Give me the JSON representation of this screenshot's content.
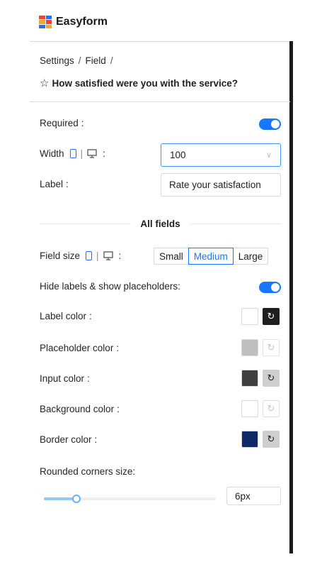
{
  "app": {
    "brand": "Easyform"
  },
  "breadcrumb": {
    "items": [
      "Settings",
      "Field"
    ],
    "separator": "/"
  },
  "question": {
    "star": "☆",
    "title": "How satisfied were you with the service?"
  },
  "required": {
    "label": "Required",
    "colon": ":",
    "on": true
  },
  "width": {
    "label": "Width",
    "value": "100",
    "colon": ":"
  },
  "label_field": {
    "label": "Label",
    "colon": ":",
    "value": "Rate your satisfaction"
  },
  "all_fields": {
    "title": "All fields"
  },
  "field_size": {
    "label": "Field size",
    "colon": ":",
    "options": [
      "Small",
      "Medium",
      "Large"
    ],
    "selected": "Medium"
  },
  "hide_labels": {
    "label": "Hide labels & show placeholders:",
    "on": true
  },
  "colors": [
    {
      "label": "Label color",
      "colon": ":",
      "swatch": "#ffffff"
    },
    {
      "label": "Placeholder color",
      "colon": ":",
      "swatch": "#bfbfbf"
    },
    {
      "label": "Input color",
      "colon": ":",
      "swatch": "#3f3f3f"
    },
    {
      "label": "Background color",
      "colon": ":",
      "swatch": "#ffffff"
    },
    {
      "label": "Border color",
      "colon": ":",
      "swatch": "#0f2a66"
    }
  ],
  "rounded": {
    "label": "Rounded corners size:",
    "value": "6px",
    "slider_fraction": 0.19
  },
  "icons": {
    "reset": "reset-icon",
    "star": "star-icon",
    "mobile": "mobile-icon",
    "desktop": "desktop-icon",
    "chevron": "chevron-down-icon"
  }
}
